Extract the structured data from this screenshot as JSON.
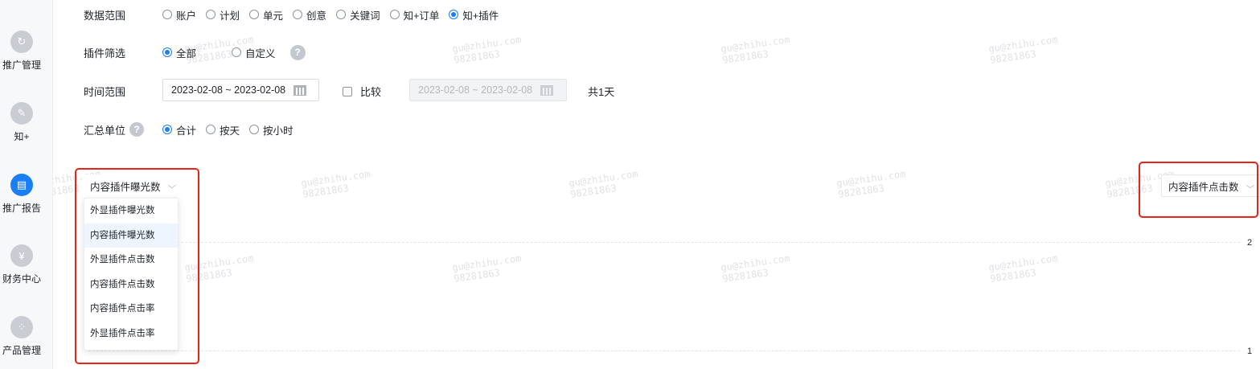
{
  "sidebar": {
    "items": [
      {
        "label": "推广管理",
        "icon": "refresh-icon",
        "glyph": "↻",
        "active": false
      },
      {
        "label": "知+",
        "icon": "pen-icon",
        "glyph": "✎",
        "active": false
      },
      {
        "label": "推广报告",
        "icon": "report-icon",
        "glyph": "▤",
        "active": true
      },
      {
        "label": "财务中心",
        "icon": "yen-icon",
        "glyph": "¥",
        "active": false
      },
      {
        "label": "产品管理",
        "icon": "grid-icon",
        "glyph": "⁘",
        "active": false
      }
    ]
  },
  "filters": {
    "data_range": {
      "label": "数据范围",
      "options": [
        "账户",
        "计划",
        "单元",
        "创意",
        "关键词",
        "知+订单",
        "知+插件"
      ],
      "selected": "知+插件"
    },
    "plugin_filter": {
      "label": "插件筛选",
      "options": [
        "全部",
        "自定义"
      ],
      "selected": "全部",
      "help_glyph": "?"
    },
    "time_range": {
      "label": "时间范围",
      "value": "2023-02-08 ~ 2023-02-08",
      "compare_label": "比较",
      "compare_value": "2023-02-08 ~ 2023-02-08",
      "total": "共1天"
    },
    "summary_unit": {
      "label": "汇总单位",
      "help_glyph": "?",
      "options": [
        "合计",
        "按天",
        "按小时"
      ],
      "selected": "合计"
    }
  },
  "chart": {
    "left_metric": {
      "value": "内容插件曝光数",
      "options": [
        "外显插件曝光数",
        "内容插件曝光数",
        "外显插件点击数",
        "内容插件点击数",
        "内容插件点击率",
        "外显插件点击率"
      ],
      "hovered": "内容插件曝光数"
    },
    "right_metric": {
      "value": "内容插件点击数"
    },
    "y_ticks": [
      "2",
      "1"
    ]
  },
  "watermark": {
    "line1": "gu@zhihu.com",
    "line2": "98281863"
  },
  "colors": {
    "accent": "#1a7ef5",
    "highlight": "#e8231a"
  }
}
